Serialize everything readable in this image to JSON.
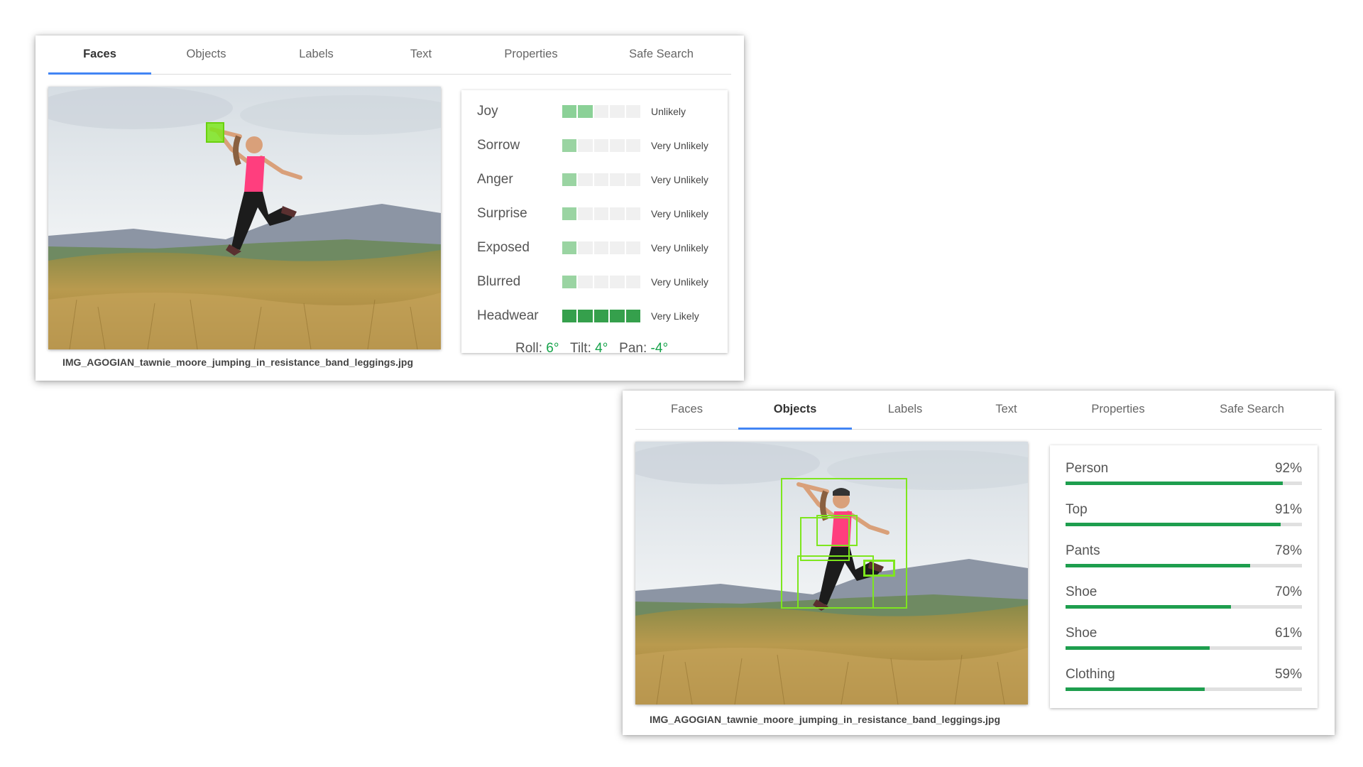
{
  "cards": {
    "faces": {
      "tabs": [
        "Faces",
        "Objects",
        "Labels",
        "Text",
        "Properties",
        "Safe Search"
      ],
      "active_tab": "Faces",
      "filename": "IMG_AGOGIAN_tawnie_moore_jumping_in_resistance_band_leggings.jpg",
      "emotions": [
        {
          "label": "Joy",
          "value": "Unlikely",
          "level": 2
        },
        {
          "label": "Sorrow",
          "value": "Very Unlikely",
          "level": 1
        },
        {
          "label": "Anger",
          "value": "Very Unlikely",
          "level": 1
        },
        {
          "label": "Surprise",
          "value": "Very Unlikely",
          "level": 1
        },
        {
          "label": "Exposed",
          "value": "Very Unlikely",
          "level": 1
        },
        {
          "label": "Blurred",
          "value": "Very Unlikely",
          "level": 1
        },
        {
          "label": "Headwear",
          "value": "Very Likely",
          "level": 5
        }
      ],
      "angles": {
        "roll_label": "Roll:",
        "roll_value": "6°",
        "tilt_label": "Tilt:",
        "tilt_value": "4°",
        "pan_label": "Pan:",
        "pan_value": "-4°"
      }
    },
    "objects": {
      "tabs": [
        "Faces",
        "Objects",
        "Labels",
        "Text",
        "Properties",
        "Safe Search"
      ],
      "active_tab": "Objects",
      "filename": "IMG_AGOGIAN_tawnie_moore_jumping_in_resistance_band_leggings.jpg",
      "items": [
        {
          "label": "Person",
          "pct": "92%",
          "score": 0.92
        },
        {
          "label": "Top",
          "pct": "91%",
          "score": 0.91
        },
        {
          "label": "Pants",
          "pct": "78%",
          "score": 0.78
        },
        {
          "label": "Shoe",
          "pct": "70%",
          "score": 0.7
        },
        {
          "label": "Shoe",
          "pct": "61%",
          "score": 0.61
        },
        {
          "label": "Clothing",
          "pct": "59%",
          "score": 0.59
        }
      ]
    }
  },
  "colors": {
    "accent": "#4285f4",
    "bar_green": "#1e9e4e",
    "likelihood_light": "#9ad4a2",
    "likelihood_strong": "#35a04c",
    "bbox": "#7ee61e"
  }
}
